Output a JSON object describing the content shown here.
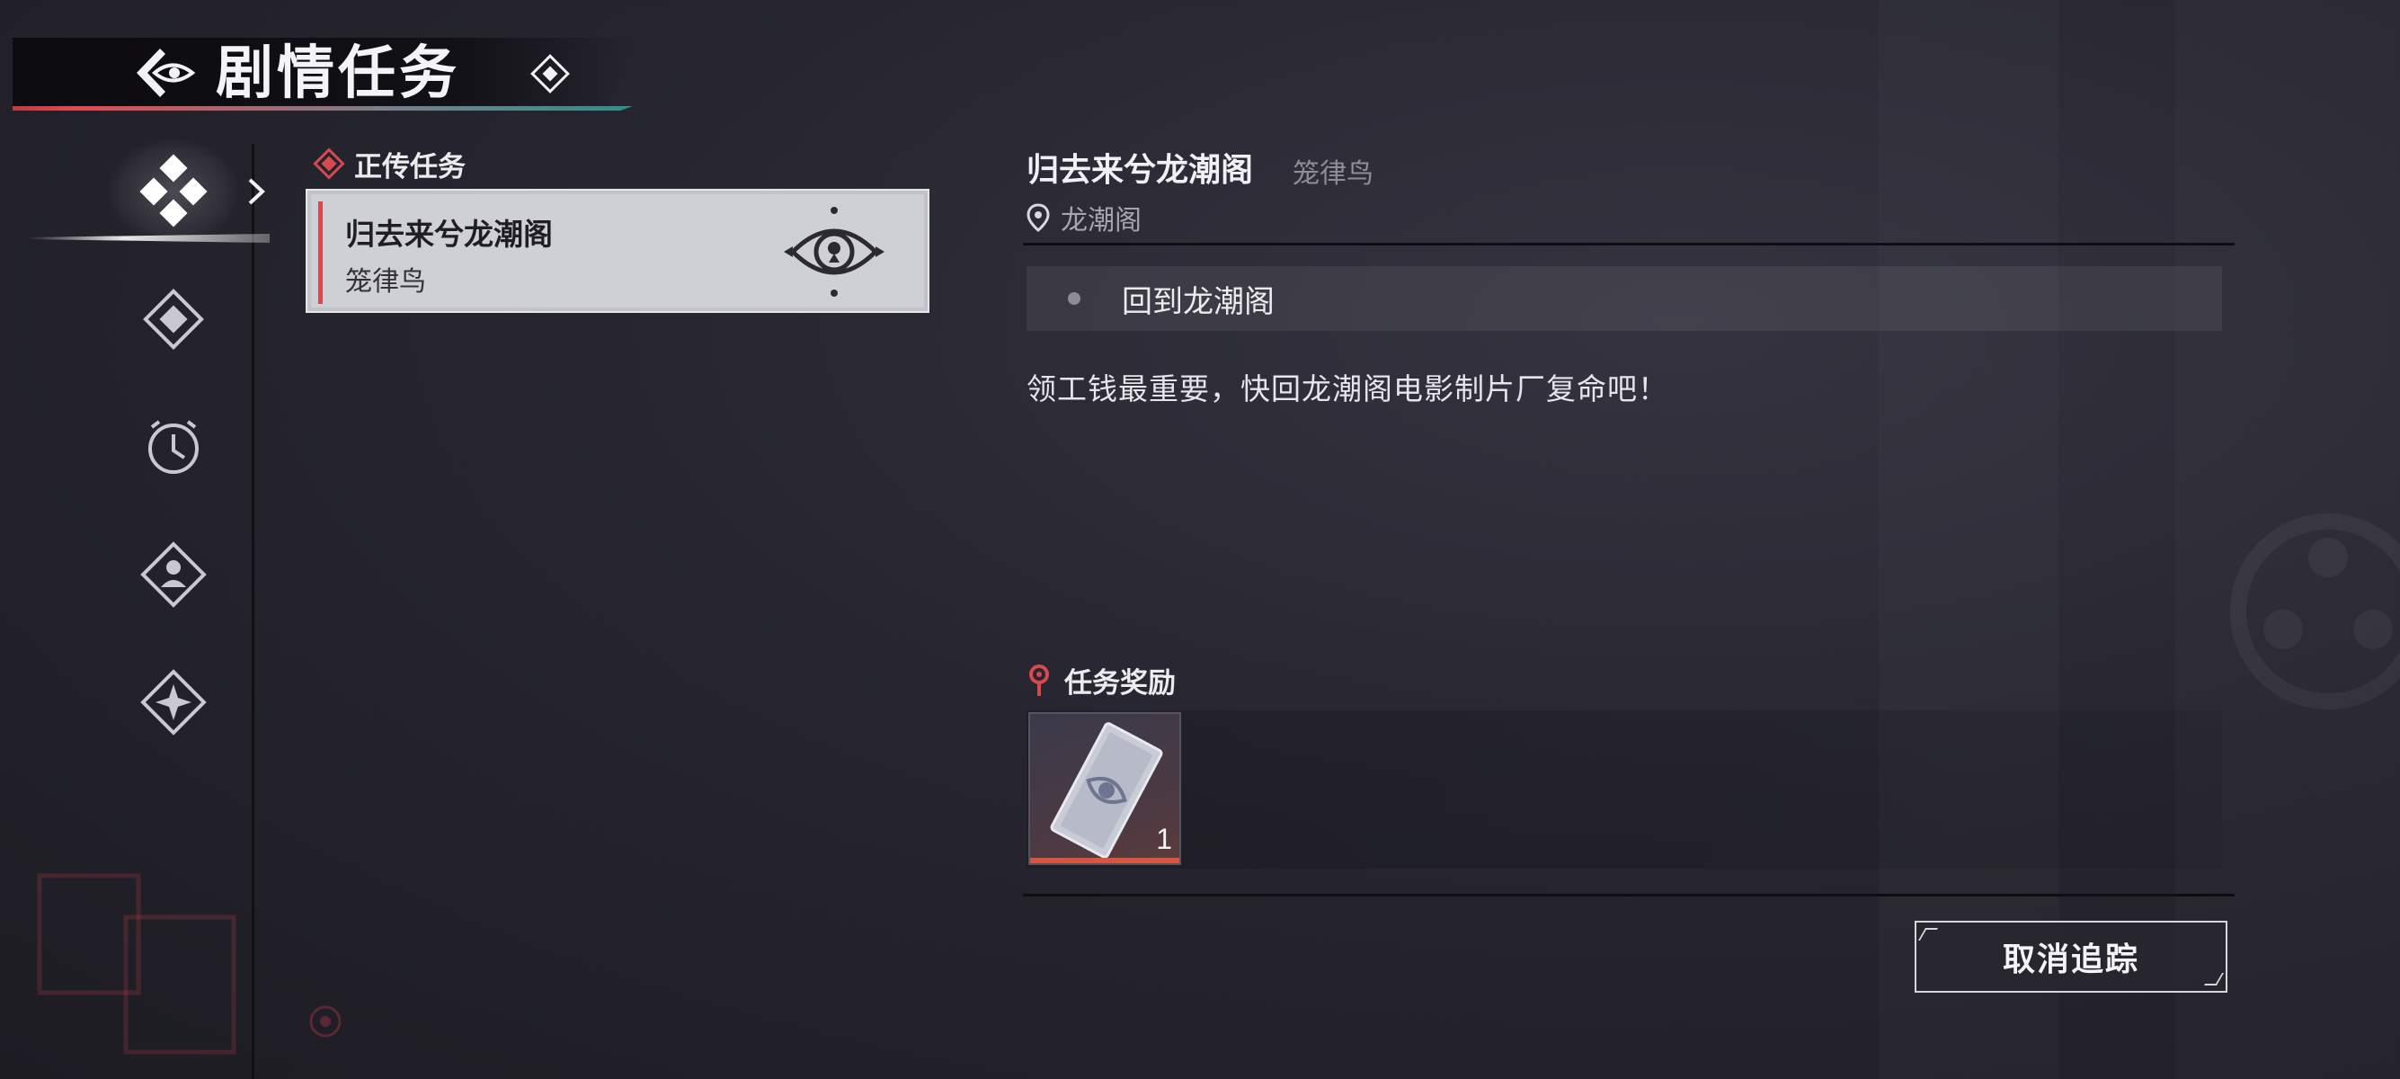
{
  "header": {
    "title": "剧情任务",
    "back_icon": "back-eye-icon",
    "tag_icon": "diamond-icon"
  },
  "sidebar": {
    "items": [
      {
        "icon": "main-story-diamonds-icon",
        "active": true
      },
      {
        "icon": "side-quest-diamond-icon",
        "active": false
      },
      {
        "icon": "clock-icon",
        "active": false
      },
      {
        "icon": "person-diamond-icon",
        "active": false
      },
      {
        "icon": "star-diamond-icon",
        "active": false
      }
    ]
  },
  "quest_list": {
    "section_title": "正传任务",
    "quests": [
      {
        "title": "归去来兮龙潮阁",
        "npc": "笼律鸟",
        "selected": true
      }
    ]
  },
  "detail": {
    "title": "归去来兮龙潮阁",
    "npc": "笼律鸟",
    "location": "龙潮阁",
    "objective": "回到龙潮阁",
    "description": "领工钱最重要，快回龙潮阁电影制片厂复命吧！",
    "reward_title": "任务奖励",
    "rewards": [
      {
        "icon": "ticket-card-icon",
        "count": "1"
      }
    ],
    "cancel_label": "取消追踪"
  },
  "colors": {
    "accent_red": "#d6494f",
    "background": "#272630",
    "card": "#cfd0d6"
  }
}
